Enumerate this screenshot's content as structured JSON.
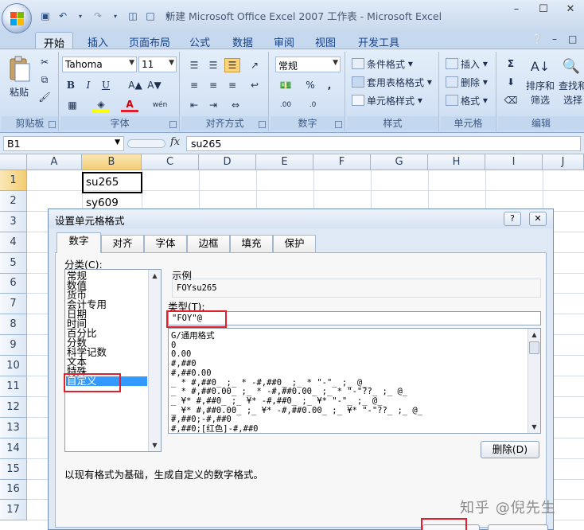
{
  "window": {
    "title": "新建 Microsoft Office Excel 2007 工作表 - Microsoft Excel",
    "controls": [
      "–",
      "☐",
      "✕"
    ]
  },
  "ribbon_tabs": [
    "开始",
    "插入",
    "页面布局",
    "公式",
    "数据",
    "审阅",
    "视图",
    "开发工具"
  ],
  "ribbon": {
    "clipboard": {
      "label": "剪贴板",
      "paste": "粘贴"
    },
    "font": {
      "label": "字体",
      "name": "Tahoma",
      "size": "11"
    },
    "alignment": {
      "label": "对齐方式"
    },
    "number": {
      "label": "数字",
      "format": "常规"
    },
    "styles": {
      "label": "样式",
      "conditional": "条件格式",
      "table": "套用表格格式",
      "cell": "单元格样式"
    },
    "cells": {
      "label": "单元格",
      "insert": "插入",
      "delete": "删除",
      "format": "格式"
    },
    "editing": {
      "label": "编辑",
      "sort_a": "排序和",
      "sort_b": "筛选",
      "find_a": "查找和",
      "find_b": "选择"
    }
  },
  "formula_bar": {
    "name_box": "B1",
    "fx": "fx",
    "value": "su265"
  },
  "columns": [
    "A",
    "B",
    "C",
    "D",
    "E",
    "F",
    "G",
    "H",
    "I",
    "J"
  ],
  "rows": [
    "1",
    "2",
    "3",
    "4",
    "5",
    "6",
    "7",
    "8",
    "9",
    "10",
    "11",
    "12",
    "13",
    "14",
    "15",
    "16",
    "17"
  ],
  "cells": {
    "B1": "su265",
    "B2": "sy609"
  },
  "dialog": {
    "title": "设置单元格格式",
    "tabs": [
      "数字",
      "对齐",
      "字体",
      "边框",
      "填充",
      "保护"
    ],
    "category_label": "分类(C):",
    "categories": [
      "常规",
      "数值",
      "货币",
      "会计专用",
      "日期",
      "时间",
      "百分比",
      "分数",
      "科学记数",
      "文本",
      "特殊",
      "自定义"
    ],
    "sample_label": "示例",
    "sample_value": "FOYsu265",
    "type_label": "类型(T):",
    "type_value": "\"FOY\"@",
    "formats": [
      "G/通用格式",
      "0",
      "0.00",
      "#,##0",
      "#,##0.00",
      "_ * #,##0_ ;_ * -#,##0_ ;_ * \"-\"_ ;_ @_",
      "_ * #,##0.00_ ;_ * -#,##0.00_ ;_ * \"-\"??_ ;_ @_",
      "_ ¥* #,##0_ ;_ ¥* -#,##0_ ;_ ¥* \"-\"_ ;_ @_",
      "_ ¥* #,##0.00_ ;_ ¥* -#,##0.00_ ;_ ¥* \"-\"??_ ;_ @_",
      "#,##0;-#,##0",
      "#,##0;[红色]-#,##0"
    ],
    "delete_button": "删除(D)",
    "description": "以现有格式为基础，生成自定义的数字格式。",
    "help": "?",
    "close": "✕"
  },
  "watermark": "知乎 @倪先生",
  "colors": {
    "highlight": "#e0202a",
    "selection": "#3399ff"
  }
}
